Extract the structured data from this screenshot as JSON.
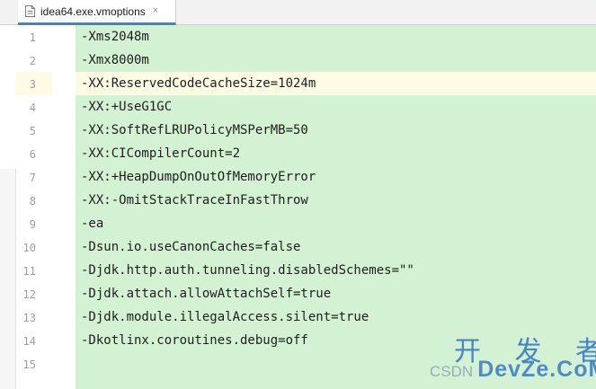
{
  "tab": {
    "filename": "idea64.exe.vmoptions",
    "close": "×"
  },
  "editor": {
    "current_line": 3,
    "lines": [
      {
        "num": "1",
        "text": "-Xms2048m"
      },
      {
        "num": "2",
        "text": "-Xmx8000m"
      },
      {
        "num": "3",
        "text": "-XX:ReservedCodeCacheSize=1024m"
      },
      {
        "num": "4",
        "text": "-XX:+UseG1GC"
      },
      {
        "num": "5",
        "text": "-XX:SoftRefLRUPolicyMSPerMB=50"
      },
      {
        "num": "6",
        "text": "-XX:CICompilerCount=2"
      },
      {
        "num": "7",
        "text": "-XX:+HeapDumpOnOutOfMemoryError"
      },
      {
        "num": "8",
        "text": "-XX:-OmitStackTraceInFastThrow"
      },
      {
        "num": "9",
        "text": "-ea"
      },
      {
        "num": "10",
        "text": "-Dsun.io.useCanonCaches=false"
      },
      {
        "num": "11",
        "text": "-Djdk.http.auth.tunneling.disabledSchemes=\"\""
      },
      {
        "num": "12",
        "text": "-Djdk.attach.allowAttachSelf=true"
      },
      {
        "num": "13",
        "text": "-Djdk.module.illegalAccess.silent=true"
      },
      {
        "num": "14",
        "text": "-Dkotlinx.coroutines.debug=off"
      },
      {
        "num": "15",
        "text": ""
      }
    ]
  },
  "watermark": {
    "title": "开 发 者",
    "prefix": "CSDN",
    "brand": "DevZe.CoM"
  },
  "colors": {
    "editor_background": "#d3f2d3",
    "current_line": "#fdfbe4",
    "tab_underline": "#4083c9",
    "watermark": "#3b79c5"
  },
  "icons": {
    "tab_icon": "file-icon"
  }
}
